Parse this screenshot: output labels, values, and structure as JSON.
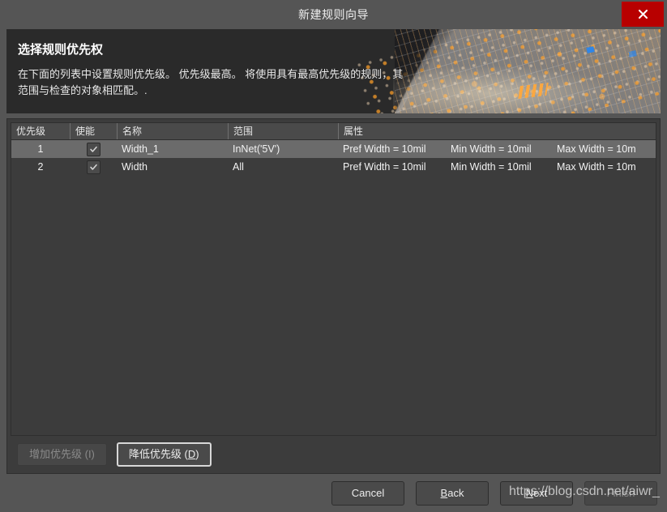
{
  "window": {
    "title": "新建规则向导",
    "close_label": "×"
  },
  "banner": {
    "title": "选择规则优先权",
    "description": "在下面的列表中设置规则优先级。 优先级最高。 将使用具有最高优先级的规则，其范围与检查的对象相匹配。."
  },
  "grid": {
    "columns": [
      {
        "key": "priority",
        "label": "优先级"
      },
      {
        "key": "enabled",
        "label": "使能"
      },
      {
        "key": "name",
        "label": "名称"
      },
      {
        "key": "scope",
        "label": "范围"
      },
      {
        "key": "attributes",
        "label": "属性"
      }
    ],
    "rows": [
      {
        "priority": "1",
        "enabled": true,
        "name": "Width_1",
        "scope": "InNet('5V')",
        "attr1": "Pref Width = 10mil",
        "attr2": "Min Width = 10mil",
        "attr3": "Max Width = 10m",
        "selected": true
      },
      {
        "priority": "2",
        "enabled": true,
        "name": "Width",
        "scope": "All",
        "attr1": "Pref Width = 10mil",
        "attr2": "Min Width = 10mil",
        "attr3": "Max Width = 10m",
        "selected": false
      }
    ]
  },
  "priority_buttons": {
    "increase": "增加优先级 (I)",
    "decrease_pre": "降低优先级 (",
    "decrease_key": "D",
    "decrease_post": ")"
  },
  "footer": {
    "cancel": "Cancel",
    "back_pre": "",
    "back_key": "B",
    "back_post": "ack",
    "next_pre": "",
    "next_key": "N",
    "next_post": "ext",
    "finish": "Finish"
  },
  "watermark": {
    "text": "https://blog.csdn.net/aiwr_"
  },
  "colors": {
    "window_bg": "#555555",
    "panel_bg": "#3c3c3c",
    "banner_bg": "#2a2a2a",
    "selected_row": "#6b6b6b",
    "close_red": "#b80000",
    "accent_orange": "#ffa83c"
  }
}
